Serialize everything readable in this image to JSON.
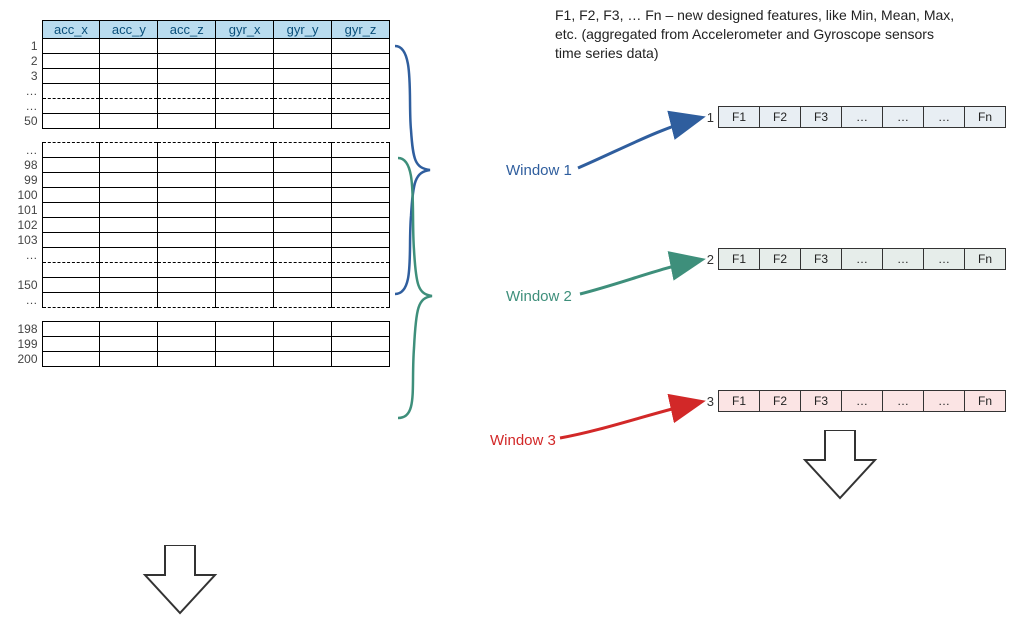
{
  "explain_text": "F1, F2, F3, … Fn – new designed features, like Min, Mean, Max, etc. (aggregated from Accelerometer and Gyroscope sensors time series data)",
  "raw_columns": [
    "acc_x",
    "acc_y",
    "acc_z",
    "gyr_x",
    "gyr_y",
    "gyr_z"
  ],
  "raw_index_labels": [
    "1",
    "2",
    "3",
    "…",
    "…",
    "50",
    "",
    "…",
    "98",
    "99",
    "100",
    "101",
    "102",
    "103",
    "…",
    "",
    "150",
    "…",
    "",
    "198",
    "199",
    "200"
  ],
  "dashed_row_flags": [
    false,
    false,
    false,
    true,
    true,
    false,
    false,
    true,
    false,
    false,
    false,
    false,
    false,
    false,
    true,
    true,
    false,
    true,
    false,
    false,
    false,
    false
  ],
  "label_only_row_flags": [
    false,
    false,
    false,
    false,
    false,
    false,
    true,
    false,
    false,
    false,
    false,
    false,
    false,
    false,
    false,
    false,
    false,
    false,
    true,
    false,
    false,
    false
  ],
  "window_labels": {
    "w1": "Window 1",
    "w2": "Window 2",
    "w3": "Window 3"
  },
  "feature_rows": [
    {
      "idx": "1",
      "cells": [
        "F1",
        "F2",
        "F3",
        "…",
        "…",
        "…",
        "Fn"
      ],
      "style": "blue"
    },
    {
      "idx": "2",
      "cells": [
        "F1",
        "F2",
        "F3",
        "…",
        "…",
        "…",
        "Fn"
      ],
      "style": "green"
    },
    {
      "idx": "3",
      "cells": [
        "F1",
        "F2",
        "F3",
        "…",
        "…",
        "…",
        "Fn"
      ],
      "style": "red"
    }
  ],
  "colors": {
    "w1": "#2f5e9e",
    "w2": "#3e8f7b",
    "w3": "#d22828",
    "header_bg": "#b9dcef"
  }
}
